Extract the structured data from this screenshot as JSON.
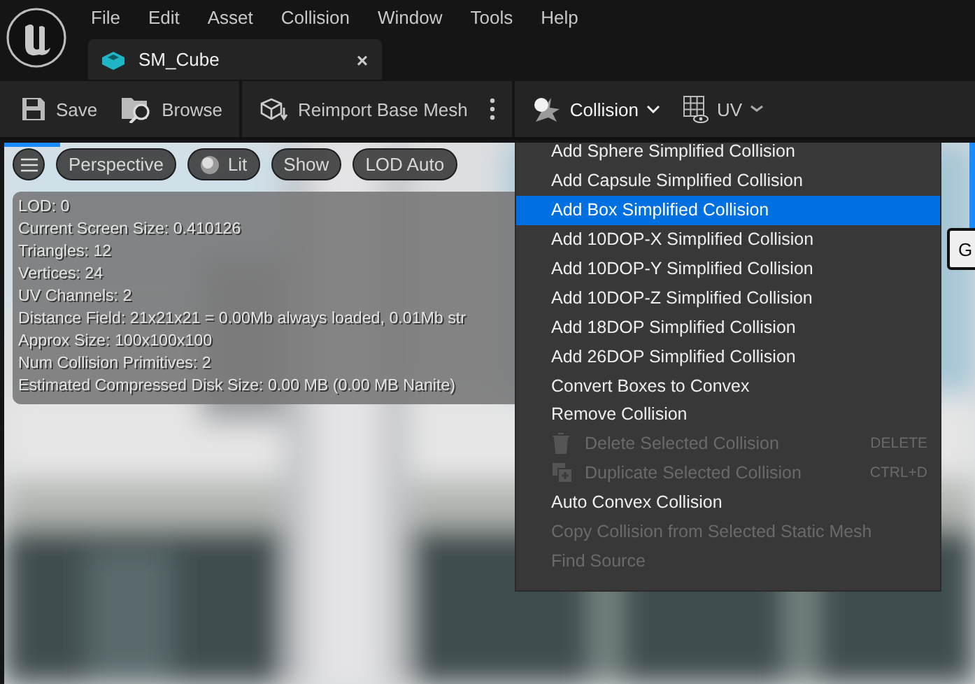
{
  "menubar": [
    "File",
    "Edit",
    "Asset",
    "Collision",
    "Window",
    "Tools",
    "Help"
  ],
  "tabs": [
    {
      "label": "SM_Cube",
      "selected": true,
      "close": "×"
    }
  ],
  "toolbar": [
    {
      "kind": "save",
      "label": "Save"
    },
    {
      "kind": "browse",
      "label": "Browse"
    },
    {
      "kind": "reimport",
      "label": "Reimport Base Mesh"
    },
    {
      "kind": "more"
    },
    {
      "kind": "collision",
      "label": "Collision",
      "expanded": true
    },
    {
      "kind": "uv",
      "label": "UV",
      "expanded": false
    }
  ],
  "viewport_toolbar": [
    {
      "kind": "menu"
    },
    {
      "kind": "text",
      "label": "Perspective"
    },
    {
      "kind": "lit",
      "label": "Lit"
    },
    {
      "kind": "text",
      "label": "Show"
    },
    {
      "kind": "text",
      "label": "LOD Auto"
    }
  ],
  "info_lines": [
    "LOD:  0",
    "Current Screen Size:  0.410126",
    "Triangles:  12",
    "Vertices:  24",
    "UV Channels:  2",
    "Distance Field:  21x21x21 = 0.00Mb always loaded, 0.01Mb str",
    "Approx Size: 100x100x100",
    "Num Collision Primitives:  2",
    "Estimated Compressed Disk Size: 0.00 MB (0.00 MB Nanite)"
  ],
  "side_button": "G",
  "collision_menu": [
    {
      "kind": "plain",
      "label": "Add Sphere Simplified Collision",
      "selected": false,
      "disabled": false
    },
    {
      "kind": "plain",
      "label": "Add Capsule Simplified Collision",
      "selected": false,
      "disabled": false
    },
    {
      "kind": "plain",
      "label": "Add Box Simplified Collision",
      "selected": true,
      "disabled": false
    },
    {
      "kind": "plain",
      "label": "Add 10DOP-X Simplified Collision",
      "selected": false,
      "disabled": false
    },
    {
      "kind": "plain",
      "label": "Add 10DOP-Y Simplified Collision",
      "selected": false,
      "disabled": false
    },
    {
      "kind": "plain",
      "label": "Add 10DOP-Z Simplified Collision",
      "selected": false,
      "disabled": false
    },
    {
      "kind": "plain",
      "label": "Add 18DOP Simplified Collision",
      "selected": false,
      "disabled": false
    },
    {
      "kind": "plain",
      "label": "Add 26DOP Simplified Collision",
      "selected": false,
      "disabled": false
    },
    {
      "kind": "plain",
      "label": "Convert Boxes to Convex",
      "selected": false,
      "disabled": false
    },
    {
      "kind": "plain",
      "label": "Remove Collision",
      "selected": false,
      "disabled": false
    },
    {
      "kind": "icon",
      "label": "Delete Selected Collision",
      "shortcut": "DELETE",
      "selected": false,
      "disabled": true
    },
    {
      "kind": "icon",
      "label": "Duplicate Selected Collision",
      "shortcut": "CTRL+D",
      "selected": false,
      "disabled": true
    },
    {
      "kind": "plain",
      "label": "Auto Convex Collision",
      "selected": false,
      "disabled": false
    },
    {
      "kind": "plain",
      "label": "Copy Collision from Selected Static Mesh",
      "selected": false,
      "disabled": true
    },
    {
      "kind": "plain",
      "label": "Find Source",
      "selected": false,
      "disabled": true
    }
  ]
}
